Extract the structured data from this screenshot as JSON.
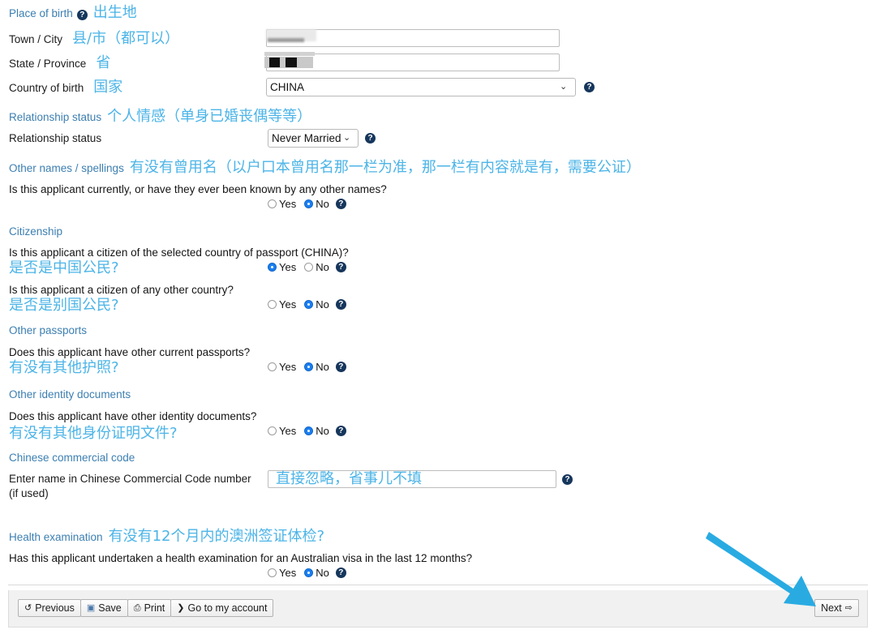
{
  "colors": {
    "section_heading": "#3c7fb1",
    "annotation": "#4cb4e7",
    "help_icon_bg": "#16365c",
    "radio_selected": "#1a7ef0",
    "arrow": "#29ABE2"
  },
  "sections": {
    "place_of_birth": {
      "heading": "Place of birth",
      "annotation": "出生地",
      "fields": {
        "town_city": {
          "label": "Town / City",
          "annotation": "县/市（都可以）",
          "value": "",
          "redacted": true
        },
        "state_province": {
          "label": "State / Province",
          "annotation": "省",
          "value": "",
          "redacted": true
        },
        "country_of_birth": {
          "label": "Country of birth",
          "annotation": "国家",
          "value": "CHINA",
          "options": [
            "CHINA"
          ]
        }
      }
    },
    "relationship_status": {
      "heading": "Relationship status",
      "annotation": "个人情感（单身已婚丧偶等等）",
      "field": {
        "label": "Relationship status",
        "value": "Never Married",
        "options": [
          "Never Married"
        ]
      }
    },
    "other_names": {
      "heading": "Other names / spellings",
      "annotation": "有没有曾用名（以户口本曾用名那一栏为准，那一栏有内容就是有，需要公证）",
      "question": "Is this applicant currently, or have they ever been known by any other names?",
      "yes_label": "Yes",
      "no_label": "No",
      "selected": "No"
    },
    "citizenship": {
      "heading": "Citizenship",
      "question1": "Is this applicant a citizen of the selected country of passport (CHINA)?",
      "annotation1": "是否是中国公民?",
      "selected1": "Yes",
      "question2": "Is this applicant a citizen of any other country?",
      "annotation2": "是否是别国公民?",
      "selected2": "No",
      "yes_label": "Yes",
      "no_label": "No"
    },
    "other_passports": {
      "heading": "Other passports",
      "question": "Does this applicant have other current passports?",
      "annotation": "有没有其他护照?",
      "selected": "No",
      "yes_label": "Yes",
      "no_label": "No"
    },
    "other_identity_documents": {
      "heading": "Other identity documents",
      "question": "Does this applicant have other identity documents?",
      "annotation": "有没有其他身份证明文件?",
      "selected": "No",
      "yes_label": "Yes",
      "no_label": "No"
    },
    "chinese_commercial_code": {
      "heading": "Chinese commercial code",
      "label_line1": "Enter name in Chinese Commercial Code number",
      "label_line2": "(if used)",
      "value": "",
      "annotation_overlay": "直接忽略，省事儿不填"
    },
    "health_examination": {
      "heading": "Health examination",
      "annotation": "有没有12个月内的澳洲签证体检?",
      "question": "Has this applicant undertaken a health examination for an Australian visa in the last 12 months?",
      "selected": "No",
      "yes_label": "Yes",
      "no_label": "No"
    }
  },
  "toolbar": {
    "previous_label": "Previous",
    "previous_icon": "rotate-left-icon",
    "save_label": "Save",
    "save_icon": "floppy-disk-icon",
    "print_label": "Print",
    "print_icon": "printer-icon",
    "account_label": "Go to my account",
    "account_icon": "chevron-right-icon",
    "next_label": "Next",
    "next_icon": "arrow-right-icon"
  },
  "glyphs": {
    "help": "?",
    "chevron_down": "⌄",
    "rotate_left": "↺",
    "floppy": "▣",
    "printer": "⎙",
    "chevron_right": "❯",
    "arrow_right": "⇨"
  }
}
